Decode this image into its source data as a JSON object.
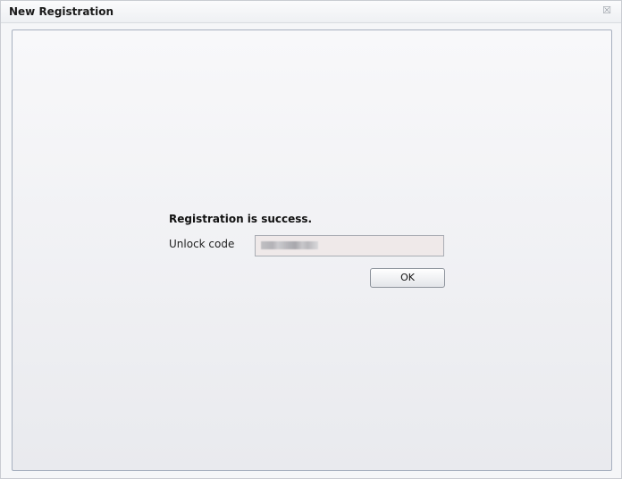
{
  "window": {
    "title": "New Registration",
    "close_glyph": "☒"
  },
  "dialog": {
    "message": "Registration is success.",
    "unlock_label": "Unlock code",
    "unlock_value": "",
    "ok_label": "OK"
  },
  "colors": {
    "input_background": "#efe9e9",
    "panel_border": "#a7b0bf"
  }
}
